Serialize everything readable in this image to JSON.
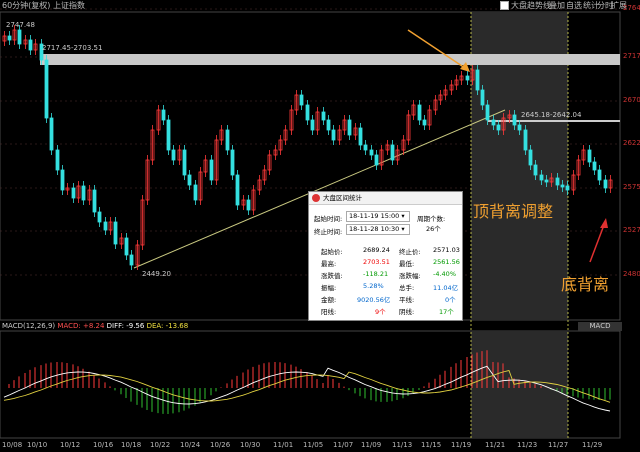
{
  "header": {
    "chart_title": "60分钟(复权)  上证指数",
    "option_label": "大盘趋势线",
    "menu_a": "叠加",
    "menu_b": "自选",
    "menu_c": "统计",
    "menu_d": "分时",
    "menu_e": "扩展"
  },
  "price_axis": [
    "2764",
    "2717",
    "2670",
    "2622",
    "2575",
    "2527",
    "2480"
  ],
  "dates": [
    "10/08",
    "10/10",
    "10/12",
    "10/16",
    "10/18",
    "10/22",
    "10/24",
    "10/26",
    "10/30",
    "11/01",
    "11/05",
    "11/07",
    "11/09",
    "11/13",
    "11/15",
    "11/19",
    "11/21",
    "11/23",
    "11/27",
    "11/29"
  ],
  "annotations": {
    "high_marker": "2747.48",
    "low_marker": "2449.20",
    "band_label": "2717.45-2703.51",
    "right_band_label": "2645.18-2642.04"
  },
  "captions": {
    "top_divergence": "顶背离调整",
    "bottom_divergence": "底背离"
  },
  "popup": {
    "title": "大盘区间统计",
    "start_label": "起始时间:",
    "start_value": "18-11-19 15:00",
    "end_label": "终止时间:",
    "end_value": "18-11-28 10:30",
    "period_label": "周期个数:",
    "period_value": "26个",
    "rows": [
      {
        "l1": "起始价:",
        "v1": "2689.24",
        "l2": "终止价:",
        "v2": "2571.03"
      },
      {
        "l1": "最高:",
        "v1": "2703.51",
        "l2": "最低:",
        "v2": "2561.56"
      },
      {
        "l1": "涨跌值:",
        "v1": "-118.21",
        "l2": "涨跌幅:",
        "v2": "-4.40%"
      },
      {
        "l1": "振幅:",
        "v1": "5.28%",
        "l2": "总手:",
        "v2": "11.04亿"
      },
      {
        "l1": "金额:",
        "v1": "9020.56亿",
        "l2": "平线:",
        "v2": "0个"
      },
      {
        "l1": "阳线:",
        "v1": "9个",
        "l2": "阴线:",
        "v2": "17个"
      }
    ]
  },
  "macd": {
    "label_name": "MACD(12,26,9)",
    "label_macd": "MACD: +8.24",
    "label_diff": "DIFF: -9.56",
    "label_dea": "DEA: -13.68",
    "button": "MACD"
  },
  "colors": {
    "up": "#ff3a3a",
    "down": "#35e0e0",
    "band": "#c8c8c8",
    "trend": "#c8c880",
    "arrow": "#f0a030",
    "shade": "#2a2a2a"
  }
}
